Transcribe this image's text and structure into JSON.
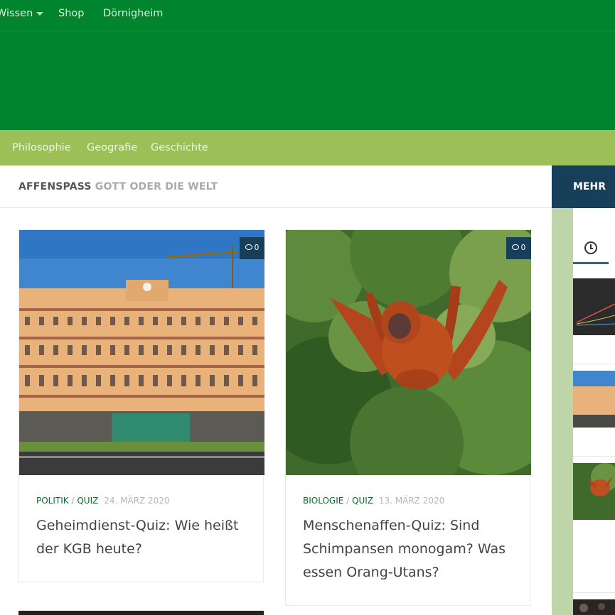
{
  "top_nav": {
    "items": [
      "Wissen",
      "Shop",
      "Dörnigheim"
    ]
  },
  "sub_nav": {
    "items": [
      "Philosophie",
      "Geografie",
      "Geschichte"
    ]
  },
  "breadcrumb": {
    "category": "AFFENSPASS",
    "subtitle": "GOTT ODER DIE WELT"
  },
  "sidebar": {
    "tab_label": "MEHR"
  },
  "posts": [
    {
      "categories": [
        "POLITIK",
        "QUIZ"
      ],
      "separator": "/",
      "date": "24. MÄRZ 2020",
      "title": "Geheimdienst-Quiz: Wie heißt der KGB heute?",
      "comments": "0"
    },
    {
      "categories": [
        "BIOLOGIE",
        "QUIZ"
      ],
      "separator": "/",
      "date": "13. MÄRZ 2020",
      "title": "Menschenaffen-Quiz: Sind Schimpansen monogam? Was essen Orang-Utans?",
      "comments": "0"
    }
  ],
  "colors": {
    "header_green": "#00842e",
    "subnav_green": "#9cc057",
    "sidebar_green": "#bed5a9",
    "navy": "#183f5a",
    "category_green": "#0d6b2d"
  }
}
